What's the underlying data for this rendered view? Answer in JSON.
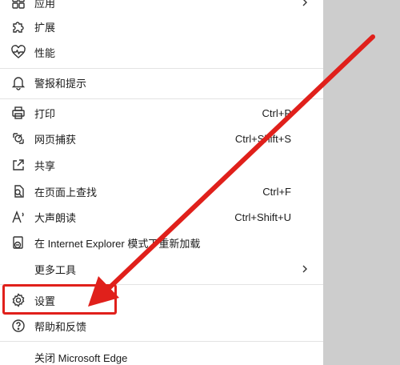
{
  "menu": {
    "apps": {
      "label": "应用",
      "icon": "apps-icon"
    },
    "extensions": {
      "label": "扩展",
      "icon": "puzzle-icon"
    },
    "performance": {
      "label": "性能",
      "icon": "heartbeat-icon"
    },
    "alerts": {
      "label": "警报和提示",
      "icon": "bell-icon"
    },
    "print": {
      "label": "打印",
      "shortcut": "Ctrl+P",
      "icon": "printer-icon"
    },
    "web_capture": {
      "label": "网页捕获",
      "shortcut": "Ctrl+Shift+S",
      "icon": "web-capture-icon"
    },
    "share": {
      "label": "共享",
      "icon": "share-icon"
    },
    "find": {
      "label": "在页面上查找",
      "shortcut": "Ctrl+F",
      "icon": "find-icon"
    },
    "read_aloud": {
      "label": "大声朗读",
      "shortcut": "Ctrl+Shift+U",
      "icon": "read-aloud-icon"
    },
    "ie_mode": {
      "label": "在 Internet Explorer 模式下重新加载",
      "icon": "ie-icon"
    },
    "more_tools": {
      "label": "更多工具",
      "icon": "chevron-right-icon"
    },
    "settings": {
      "label": "设置",
      "icon": "gear-icon"
    },
    "help": {
      "label": "帮助和反馈",
      "icon": "help-icon"
    },
    "close": {
      "label": "关闭 Microsoft Edge"
    }
  },
  "annotation": {
    "color": "#e0201b"
  }
}
